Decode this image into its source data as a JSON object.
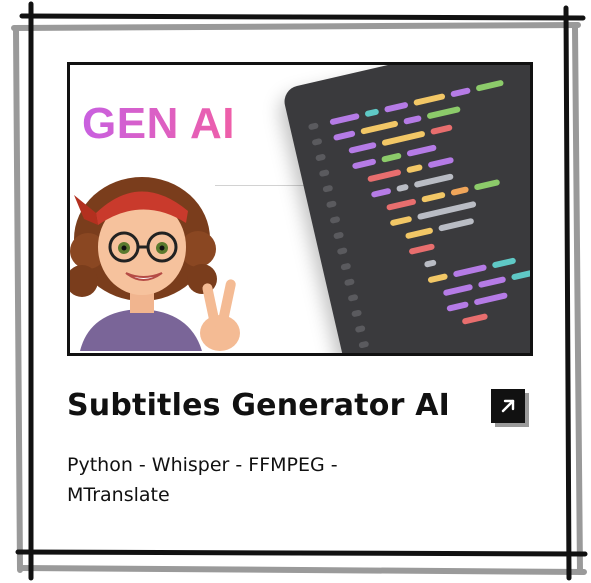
{
  "card": {
    "thumbnail": {
      "headline": "GEN AI",
      "alt_description": ""
    },
    "title": "Subtitles Generator AI",
    "tech_stack_line1": "Python - Whisper - FFMPEG -",
    "tech_stack_line2": "MTranslate",
    "link_icon": "arrow-up-right-icon"
  },
  "colors": {
    "frame": "#111111",
    "frame_shadow": "#9a9a9a",
    "gen_ai_gradient_start": "#c860e0",
    "gen_ai_gradient_end": "#ef5fa8",
    "code_panel": "#3a3a3d",
    "button_bg": "#111111"
  }
}
